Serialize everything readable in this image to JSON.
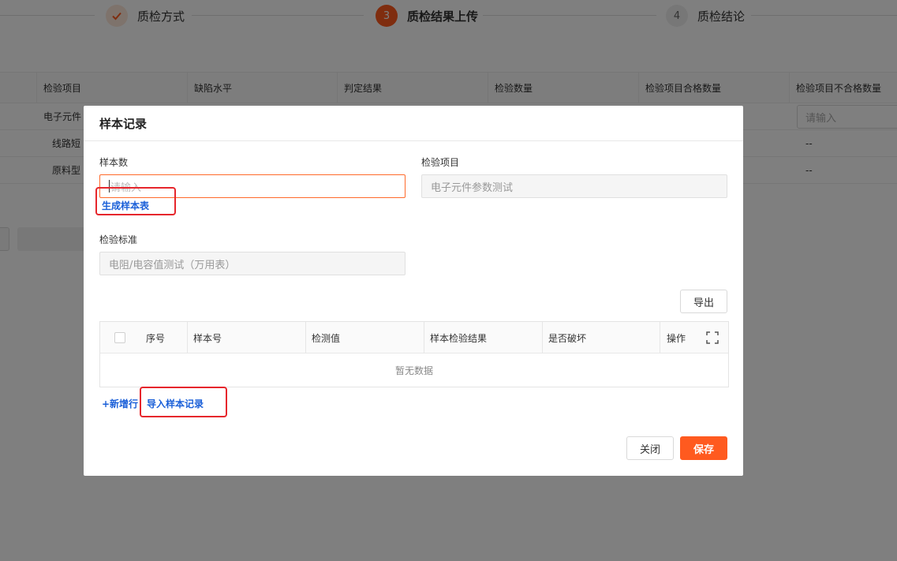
{
  "steps": [
    {
      "label": "质检方式",
      "number": "✓",
      "state": "done"
    },
    {
      "label": "质检结果上传",
      "number": "3",
      "state": "active"
    },
    {
      "label": "质检结论",
      "number": "4",
      "state": "todo"
    }
  ],
  "background_table": {
    "columns": [
      "检验项目",
      "缺陷水平",
      "判定结果",
      "检验数量",
      "检验项目合格数量",
      "检验项目不合格数量"
    ],
    "rows": [
      {
        "item": "电子元件",
        "input_placeholder": "请输入"
      },
      {
        "item": "线路短",
        "value": "--"
      },
      {
        "item": "原料型",
        "value": "--"
      }
    ]
  },
  "modal": {
    "title": "样本记录",
    "sample_count": {
      "label": "样本数",
      "placeholder": "请输入"
    },
    "inspection_item": {
      "label": "检验项目",
      "value": "电子元件参数测试"
    },
    "inspection_standard": {
      "label": "检验标准",
      "value": "电阻/电容值测试（万用表）"
    },
    "generate_link": "生成样本表",
    "export_button": "导出",
    "table": {
      "columns": [
        "序号",
        "样本号",
        "检测值",
        "样本检验结果",
        "是否破坏",
        "操作"
      ],
      "empty_text": "暂无数据"
    },
    "add_row_link": "+新增行",
    "import_link": "导入样本记录",
    "close_button": "关闭",
    "save_button": "保存"
  },
  "colors": {
    "accent": "#ff5a1f",
    "link": "#1a5fd8",
    "highlight": "#e6262c"
  }
}
